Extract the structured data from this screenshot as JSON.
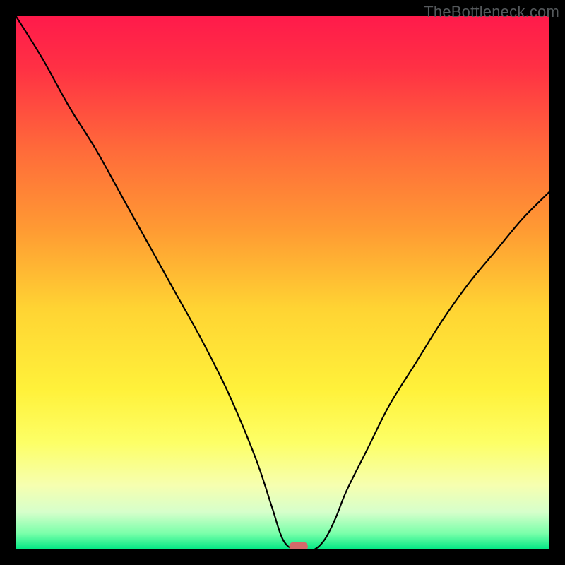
{
  "watermark": "TheBottleneck.com",
  "chart_data": {
    "type": "line",
    "title": "",
    "xlabel": "",
    "ylabel": "",
    "xlim": [
      0,
      100
    ],
    "ylim": [
      0,
      100
    ],
    "grid": false,
    "background": {
      "type": "vertical-gradient",
      "stops": [
        {
          "offset": 0.0,
          "color": "#ff1a4b"
        },
        {
          "offset": 0.1,
          "color": "#ff3144"
        },
        {
          "offset": 0.25,
          "color": "#ff6a3a"
        },
        {
          "offset": 0.4,
          "color": "#ff9a33"
        },
        {
          "offset": 0.55,
          "color": "#ffd433"
        },
        {
          "offset": 0.7,
          "color": "#fff13a"
        },
        {
          "offset": 0.8,
          "color": "#fdff66"
        },
        {
          "offset": 0.88,
          "color": "#f6ffb0"
        },
        {
          "offset": 0.93,
          "color": "#d6ffcb"
        },
        {
          "offset": 0.97,
          "color": "#7affaa"
        },
        {
          "offset": 1.0,
          "color": "#00e884"
        }
      ]
    },
    "series": [
      {
        "name": "bottleneck-curve",
        "color": "#000000",
        "stroke_width": 2.2,
        "x": [
          0,
          5,
          10,
          15,
          20,
          25,
          30,
          35,
          40,
          45,
          48,
          50,
          52,
          54,
          56,
          58,
          60,
          62,
          66,
          70,
          75,
          80,
          85,
          90,
          95,
          100
        ],
        "y_pct": [
          100,
          92,
          83,
          75,
          66,
          57,
          48,
          39,
          29,
          17,
          8,
          2,
          0,
          0,
          0,
          2,
          6,
          11,
          19,
          27,
          35,
          43,
          50,
          56,
          62,
          67
        ]
      }
    ],
    "marker": {
      "name": "optimal-point",
      "x": 53,
      "y_pct": 0,
      "color": "#d46a6a",
      "width": 3.5,
      "height": 1.8
    }
  }
}
